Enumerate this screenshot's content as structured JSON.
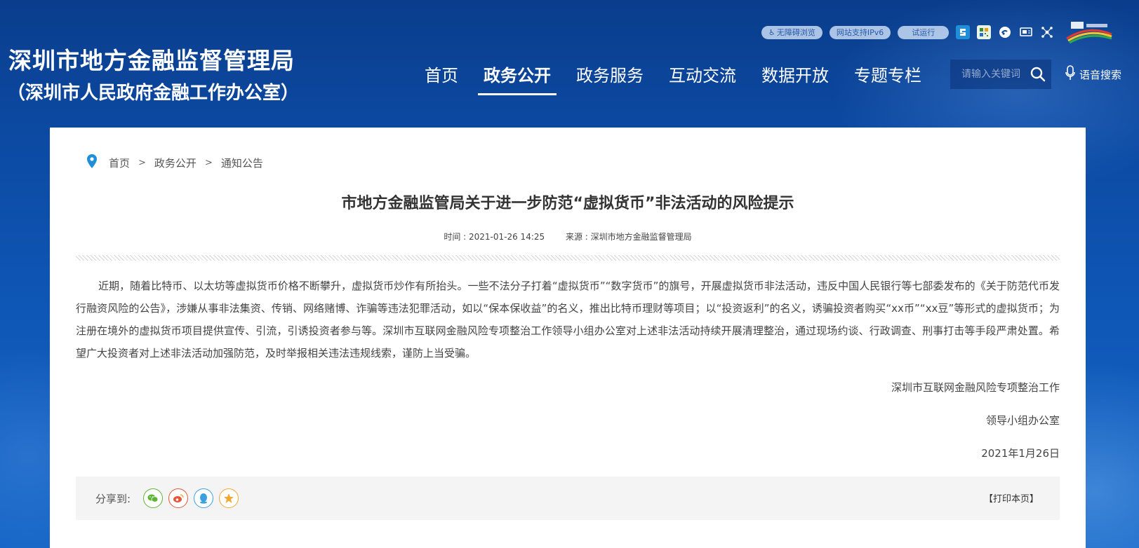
{
  "header": {
    "site_title": "深圳市地方金融监督管理局",
    "site_subtitle": "（深圳市人民政府金融工作办公室）",
    "tools": {
      "accessibility": "无障碍浏览",
      "ipv6": "网站支持IPv6",
      "trial": "试运行"
    },
    "nav": [
      {
        "label": "首页"
      },
      {
        "label": "政务公开"
      },
      {
        "label": "政务服务"
      },
      {
        "label": "互动交流"
      },
      {
        "label": "数据开放"
      },
      {
        "label": "专题专栏"
      }
    ],
    "search": {
      "placeholder": "请输入关键词"
    },
    "voice_search": "语音搜索"
  },
  "breadcrumb": [
    "首页",
    "政务公开",
    "通知公告"
  ],
  "breadcrumb_sep": ">",
  "article": {
    "title": "市地方金融监管局关于进一步防范“虚拟货币”非法活动的风险提示",
    "time": "时间 : 2021-01-26 14:25",
    "source": "来源 : 深圳市地方金融监督管理局",
    "body": "近期，随着比特币、以太坊等虚拟货币价格不断攀升，虚拟货币炒作有所抬头。一些不法分子打着“虚拟货币”“数字货币”的旗号，开展虚拟货币非法活动，违反中国人民银行等七部委发布的《关于防范代币发行融资风险的公告》，涉嫌从事非法集资、传销、网络赌博、诈骗等违法犯罪活动，如以“保本保收益”的名义，推出比特币理财等项目；以“投资返利”的名义，诱骗投资者购买“xx币”“xx豆”等形式的虚拟货币；为注册在境外的虚拟货币项目提供宣传、引流，引诱投资者参与等。深圳市互联网金融风险专项整治工作领导小组办公室对上述非法活动持续开展清理整治，通过现场约谈、行政调查、刑事打击等手段严肃处置。希望广大投资者对上述非法活动加强防范，及时举报相关违法违规线索，谨防上当受骗。",
    "sign_line1": "深圳市互联网金融风险专项整治工作",
    "sign_line2": "领导小组办公室",
    "date": "2021年1月26日"
  },
  "share": {
    "label": "分享到:",
    "print": "【打印本页】"
  },
  "colors": {
    "header_bg": "#0c4aa3",
    "card_bg": "#ffffff",
    "wechat": "#5cb531",
    "weibo": "#e8543a",
    "qq": "#3aa0e0",
    "favorite": "#f2a92f"
  }
}
